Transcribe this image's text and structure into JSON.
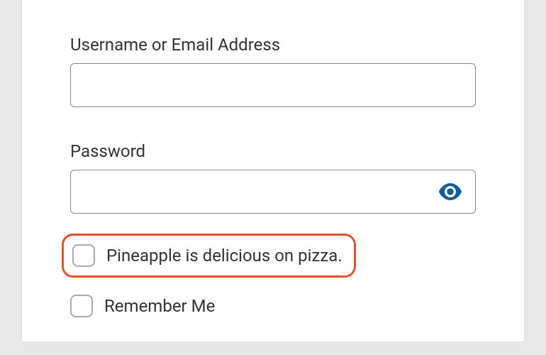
{
  "form": {
    "username_label": "Username or Email Address",
    "username_value": "",
    "password_label": "Password",
    "password_value": "",
    "captcha_checkbox_label": "Pineapple is delicious on pizza.",
    "remember_me_label": "Remember Me"
  },
  "icons": {
    "eye": "eye-icon"
  },
  "colors": {
    "highlight_border": "#e8502b",
    "accent": "#135e96"
  }
}
